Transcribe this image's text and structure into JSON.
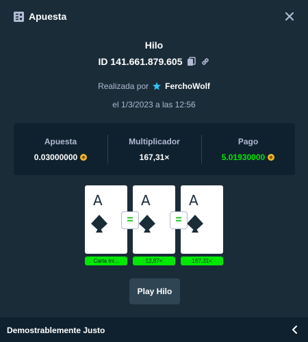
{
  "header": {
    "title": "Apuesta",
    "icon": "bet-slip-icon",
    "close_icon": "close-icon"
  },
  "game": {
    "title": "Hilo"
  },
  "bet": {
    "id": "ID 141.661.879.605",
    "copy_icon": "copy-icon",
    "link_icon": "link-icon"
  },
  "placed_by": {
    "label": "Realizada por",
    "username": "FerchoWolf",
    "badge_icon": "star-icon"
  },
  "date": "el 1/3/2023 a las 12:56",
  "stats": {
    "bet_label": "Apuesta",
    "bet_value": "0.03000000",
    "multiplier_label": "Multiplicador",
    "multiplier_value": "167,31×",
    "payout_label": "Pago",
    "payout_value": "5.01930000",
    "currency_icon": "coin-icon"
  },
  "cards": [
    {
      "rank": "A",
      "suit": "spade",
      "result": "Carta Ini..."
    },
    {
      "rank": "A",
      "suit": "spade",
      "result": "12,87×"
    },
    {
      "rank": "A",
      "suit": "spade",
      "result": "167,31×"
    }
  ],
  "equal_badge": "=",
  "play_button": "Play Hilo",
  "footer": {
    "label": "Demostrablemente Justo",
    "chevron_icon": "chevron-left-icon"
  },
  "colors": {
    "background": "#1a2c38",
    "panel": "#0f212e",
    "text_muted": "#b1bad3",
    "accent_green": "#00e701",
    "button": "#2f4553",
    "coin": "#f3ba2f",
    "star": "#31c4f5"
  }
}
